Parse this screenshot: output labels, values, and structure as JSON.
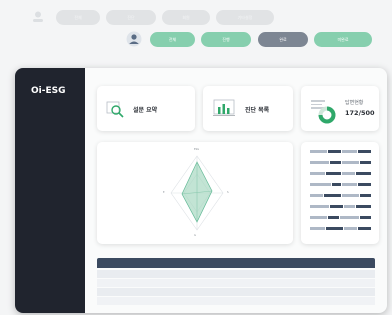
{
  "top_filters": {
    "row1": {
      "labels": [
        "전체",
        "진단",
        "회원",
        "기타설정"
      ]
    },
    "row2": {
      "labels": [
        "전체",
        "진행",
        "완료",
        "미완료"
      ],
      "colors": [
        "#86cfae",
        "#86cfae",
        "#7d8693",
        "#86cfae"
      ]
    }
  },
  "app": {
    "name": "Oi-ESG"
  },
  "cards": {
    "survey": {
      "label": "설문 요약",
      "icon": "magnifier-chart-icon"
    },
    "diagnosis": {
      "label": "진단 목록",
      "icon": "bar-chart-icon"
    },
    "responses": {
      "title": "답변현황",
      "value": "172/500",
      "icon": "donut-chart-icon"
    }
  },
  "radar": {
    "labels": {
      "top": "ESG",
      "left": "E",
      "right": "S",
      "bottom": "G"
    }
  },
  "bars": {
    "count": 8
  },
  "table": {
    "rows": 4
  },
  "colors": {
    "sidebar": "#20242e",
    "accent": "#2fa86a",
    "bar_dark": "#3b4a60",
    "bar_light": "#aeb8c6"
  }
}
